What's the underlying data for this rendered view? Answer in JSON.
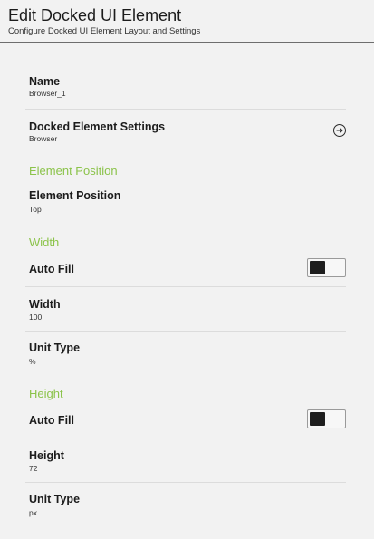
{
  "header": {
    "title": "Edit Docked UI Element",
    "subtitle": "Configure Docked UI Element Layout and Settings"
  },
  "name": {
    "label": "Name",
    "value": "Browser_1"
  },
  "docked_settings": {
    "label": "Docked Element Settings",
    "value": "Browser",
    "icon": "arrow-right-circle-icon"
  },
  "element_position_section": {
    "title": "Element Position"
  },
  "element_position": {
    "label": "Element Position",
    "value": "Top"
  },
  "width_section": {
    "title": "Width",
    "auto_fill": {
      "label": "Auto Fill",
      "enabled": false
    },
    "width": {
      "label": "Width",
      "value": "100"
    },
    "unit_type": {
      "label": "Unit Type",
      "value": "%"
    }
  },
  "height_section": {
    "title": "Height",
    "auto_fill": {
      "label": "Auto Fill",
      "enabled": false
    },
    "height": {
      "label": "Height",
      "value": "72"
    },
    "unit_type": {
      "label": "Unit Type",
      "value": "px"
    }
  },
  "colors": {
    "accent": "#8bc34a",
    "background": "#f2f2f2",
    "toggle_knob": "#1e1e1e"
  }
}
